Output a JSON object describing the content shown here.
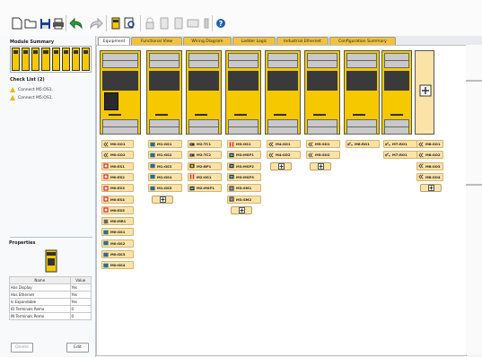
{
  "sidebar": {
    "module_summary_title": "Module Summary",
    "checklist_title": "Check List (2)",
    "checklist": [
      "Connect M5:OS1.",
      "Connect M5:OS1."
    ],
    "properties_title": "Properties",
    "props_headers": [
      "Name",
      "Value"
    ],
    "props": [
      [
        "Has Display",
        "Yes"
      ],
      [
        "Has Ethernet",
        "Yes"
      ],
      [
        "Is Expandable",
        "Yes"
      ],
      [
        "IO Terminals Remo",
        "0"
      ],
      [
        "IN Terminals Remo",
        "0"
      ]
    ],
    "delete_label": "Delete",
    "edit_label": "Edit"
  },
  "tabs": [
    "Equipment",
    "Functional View",
    "Wiring Diagram",
    "Ladder Logic",
    "Industrial Ethernet",
    "Configuration Summary"
  ],
  "modules": [
    {
      "io": [
        "M0:SO1",
        "M0:SO2",
        "M0:ES1",
        "M0:ES2",
        "M0:ES3",
        "M0:ES4",
        "M0:ES5",
        "M0:MR1",
        "M0:GS1",
        "M0:GS2",
        "M0:GS3",
        "M0:GS4"
      ],
      "icons": [
        "arrow",
        "arrow",
        "estop",
        "estop",
        "estop",
        "estop",
        "estop",
        "relay",
        "gate",
        "gate",
        "gate",
        "gate"
      ],
      "add": false
    },
    {
      "io": [
        "M1:GS1",
        "M1:GS2",
        "M1:GS3",
        "M1:GS4",
        "M1:GS5"
      ],
      "icons": [
        "gate",
        "gate",
        "gate",
        "gate",
        "gate"
      ],
      "add": true
    },
    {
      "io": [
        "M2:TC1",
        "M2:TC2",
        "M2:BP1",
        "M2:OS1",
        "M2:MSP1"
      ],
      "icons": [
        "tc",
        "tc",
        "bp",
        "os",
        "msp"
      ],
      "add": false
    },
    {
      "io": [
        "M3:OS1",
        "M3:MSP1",
        "M3:MSP2",
        "M3:MSP3",
        "M3:SM1",
        "M3:SM2"
      ],
      "icons": [
        "os",
        "msp",
        "msp",
        "msp",
        "sm",
        "sm"
      ],
      "add": true
    },
    {
      "io": [
        "M4:SO1",
        "M4:SO2"
      ],
      "icons": [
        "arrow",
        "arrow"
      ],
      "add": true
    },
    {
      "io": [
        "M5:SO1",
        "M5:SO2"
      ],
      "icons": [
        "arrow",
        "arrow"
      ],
      "add": true
    },
    {
      "io": [
        "M6:RO1"
      ],
      "icons": [
        "ro"
      ],
      "add": false
    },
    {
      "io": [
        "M7:RO1",
        "M7:RO1"
      ],
      "icons": [
        "ro",
        "ro"
      ],
      "add": false
    },
    {
      "io": [
        "M8:SO1",
        "M8:SO2",
        "M8:SO3",
        "M8:SO4"
      ],
      "icons": [
        "arrow",
        "arrow",
        "arrow",
        "arrow"
      ],
      "add": true
    }
  ]
}
